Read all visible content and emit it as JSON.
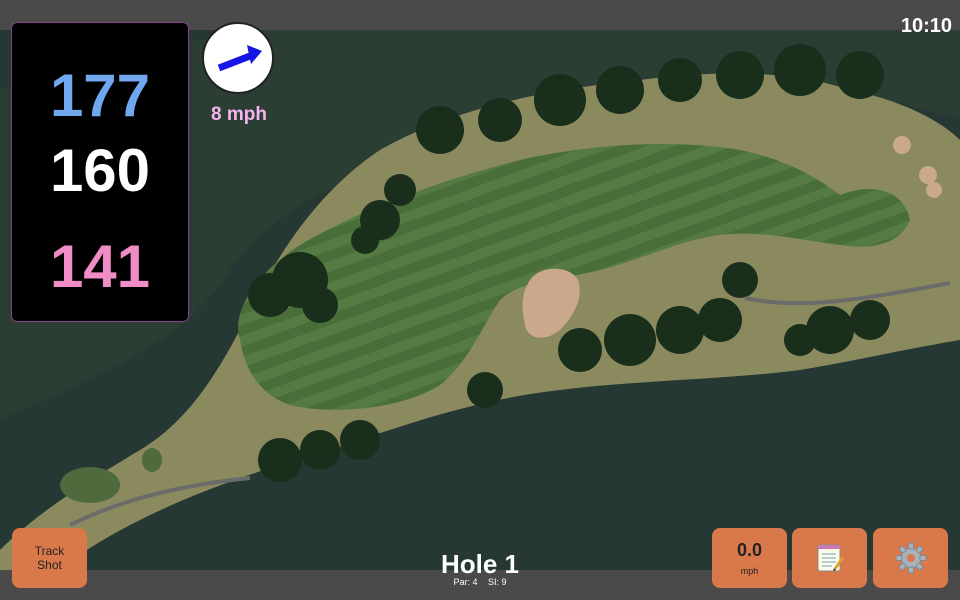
{
  "status": {
    "time": "10:10"
  },
  "distances": {
    "back": "177",
    "middle": "160",
    "front": "141",
    "back_color": "#6fa8ef",
    "middle_color": "#ffffff",
    "front_color": "#f08cc6"
  },
  "wind": {
    "speed_label": "8 mph",
    "arrow_color": "#1515e6",
    "label_color": "#f6b4f0"
  },
  "track_shot": {
    "line1": "Track",
    "line2": "Shot"
  },
  "hole": {
    "title": "Hole 1",
    "par_label": "Par: 4",
    "si_label": "SI: 9"
  },
  "speed": {
    "value": "0.0",
    "unit": "mph"
  },
  "icons": {
    "notes": "notepad-icon",
    "settings": "gear-icon",
    "wind": "wind-arrow-icon"
  },
  "colors": {
    "button": "#d9794a",
    "panel_border": "#8a3d8f",
    "bar": "#4a4a4a"
  }
}
